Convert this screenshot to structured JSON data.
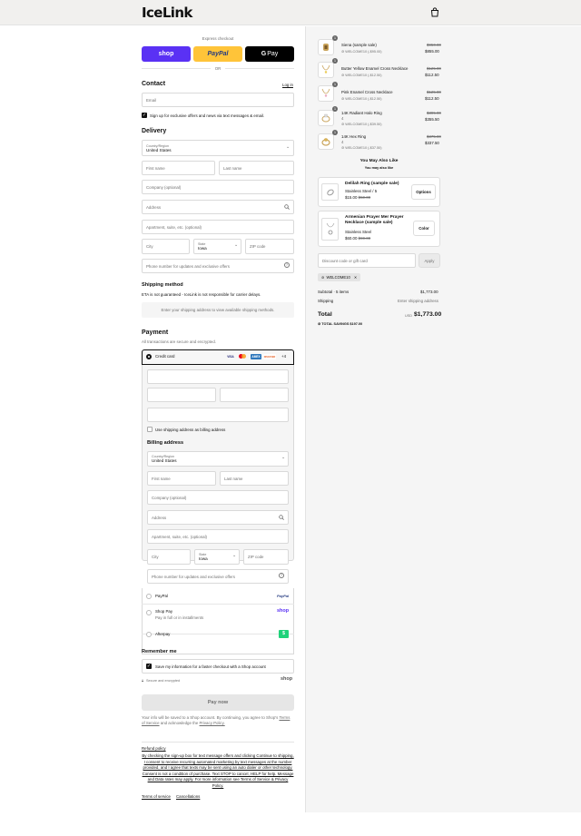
{
  "header": {
    "logo": "IceLink",
    "cart_icon": "shopping-bag-icon"
  },
  "express": {
    "title": "Express checkout",
    "shop": "shop",
    "paypal": "PayPal",
    "gpay": "Pay",
    "or": "OR"
  },
  "contact": {
    "title": "Contact",
    "login": "Log in",
    "email_placeholder": "Email",
    "marketing": "Sign up for exclusive offers and news via text messages & email."
  },
  "delivery": {
    "title": "Delivery",
    "country_label": "Country/Region",
    "country": "United States",
    "first": "First name",
    "last": "Last name",
    "company": "Company (optional)",
    "address": "Address",
    "apt": "Apartment, suite, etc. (optional)",
    "city": "City",
    "state_label": "State",
    "state": "Iowa",
    "zip": "ZIP code",
    "phone": "Phone number for updates and exclusive offers"
  },
  "shipping": {
    "title": "Shipping method",
    "eta": "ETA is not guaranteed - IceLink is not responsible for carrier delays.",
    "notice": "Enter your shipping address to view available shipping methods."
  },
  "payment": {
    "title": "Payment",
    "subtitle": "All transactions are secure and encrypted.",
    "credit_card": "Credit card",
    "card_brands": [
      "VISA",
      "MC",
      "AMEX",
      "DISCOVER",
      "+4"
    ],
    "use_shipping": "Use shipping address as billing address",
    "billing_title": "Billing address",
    "options": [
      {
        "label": "PayPal",
        "sub": "",
        "logo": "PayPal"
      },
      {
        "label": "Shop Pay",
        "sub": "Pay in full or in installments",
        "logo": "shop"
      },
      {
        "label": "Afterpay",
        "sub": "",
        "logo": "afterpay-icon"
      }
    ]
  },
  "remember": {
    "title": "Remember me",
    "save": "Save my information for a faster checkout with a Shop account",
    "secure": "Secure and encrypted",
    "shop": "shop"
  },
  "pay": {
    "button": "Pay now",
    "legal_1": "Your info will be saved to a Shop account. By continuing, you agree to Shop's",
    "terms": "Terms of Service",
    "legal_2": "and acknowledge the",
    "privacy": "Privacy Policy."
  },
  "footer": {
    "refund": "Refund policy",
    "consent": "By checking the sign-up box for text message offers and clicking Continue to shipping, I consent to receive recurring automated marketing by text messages at the number provided, and I agree that texts may be sent using an auto dialer or other technology. Consent is not a condition of purchase. Text STOP to cancel, HELP for help. Message and Data rates may apply. For more information see Terms of Service & Privacy Policy.",
    "terms": "Terms of service",
    "cancellations": "Cancellations"
  },
  "cart": {
    "items": [
      {
        "name": "Siena (sample sale)",
        "variant": "",
        "discount": "WELCOME10 (-$95.00)",
        "old": "$950.00",
        "price": "$855.00",
        "qty": "1"
      },
      {
        "name": "Butter Yellow Enamel Cross Necklace",
        "variant": "",
        "discount": "WELCOME10 (-$12.50)",
        "old": "$125.00",
        "price": "$112.50",
        "qty": "1"
      },
      {
        "name": "Pink Enamel Cross Necklace",
        "variant": "",
        "discount": "WELCOME10 (-$12.50)",
        "old": "$125.00",
        "price": "$112.50",
        "qty": "1"
      },
      {
        "name": "14K Radiant Halo Ring",
        "variant": "4",
        "discount": "WELCOME10 (-$39.50)",
        "old": "$395.00",
        "price": "$355.50",
        "qty": "1"
      },
      {
        "name": "14K Hex Ring",
        "variant": "4",
        "discount": "WELCOME10 (-$37.50)",
        "old": "$375.00",
        "price": "$337.50",
        "qty": "1"
      }
    ],
    "also_like_title": "You May Also Like",
    "also_like_sub": "You may also like",
    "recs": [
      {
        "name": "Delilah Ring (sample sale)",
        "variant": "Stainless Steel / 5",
        "price": "$15.00",
        "old": "$50.00",
        "button": "Options"
      },
      {
        "name": "Armenian Prayer Mer Prayer Necklace (sample sale)",
        "variant": "Stainless Steel",
        "price": "$60.00",
        "old": "$90.00",
        "button": "Color"
      }
    ],
    "discount_placeholder": "Discount code or gift card",
    "apply": "Apply",
    "code": "WELCOME10",
    "subtotal_label": "Subtotal · 5 items",
    "subtotal": "$1,773.00",
    "shipping_label": "Shipping",
    "shipping_value": "Enter shipping address",
    "total_label": "Total",
    "currency": "USD",
    "total": "$1,773.00",
    "savings_label": "TOTAL SAVINGS",
    "savings": "$197.00"
  }
}
